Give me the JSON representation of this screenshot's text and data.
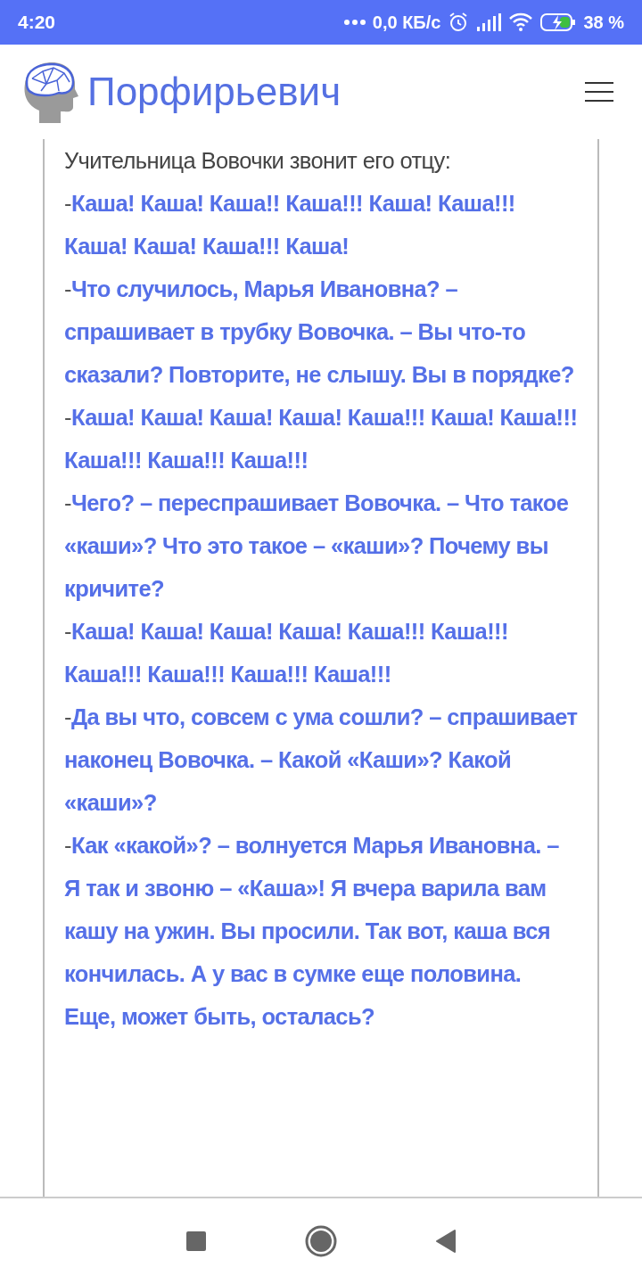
{
  "status_bar": {
    "time": "4:20",
    "network_speed": "0,0 КБ/с",
    "battery": "38 %"
  },
  "header": {
    "title": "Порфирьевич"
  },
  "story": [
    {
      "kind": "plain",
      "text": "Учительница Вовочки звонит его отцу:"
    },
    {
      "kind": "generated",
      "dash": "-",
      "text": "Каша! Каша! Каша!! Каша!!! Каша! Каша!!! Каша! Каша! Каша!!! Каша!"
    },
    {
      "kind": "generated",
      "dash": "-",
      "text": "Что случилось, Марья Ивановна? – спрашивает в трубку Вовочка. – Вы что-то сказали? Повторите, не слышу. Вы в порядке?"
    },
    {
      "kind": "generated",
      "dash": "-",
      "text": "Каша! Каша! Каша! Каша! Каша!!! Каша! Каша!!! Каша!!! Каша!!! Каша!!!"
    },
    {
      "kind": "generated",
      "dash": "-",
      "text": "Чего? – переспрашивает Вовочка. – Что такое «каши»? Что это такое – «каши»? Почему вы кричите?"
    },
    {
      "kind": "generated",
      "dash": "-",
      "text": "Каша! Каша! Каша! Каша! Каша!!! Каша!!! Каша!!! Каша!!! Каша!!! Каша!!!"
    },
    {
      "kind": "generated",
      "dash": "-",
      "text": "Да вы что, совсем с ума сошли? – спрашивает наконец Вовочка. – Какой «Каши»? Какой «каши»?"
    },
    {
      "kind": "generated",
      "dash": "-",
      "text": "Как «какой»? – волнуется Марья Ивановна. – Я так и звоню – «Каша»! Я вчера варила вам кашу на ужин. Вы просили. Так вот, каша вся кончилась. А у вас в сумке еще половина. Еще, может быть, осталась?"
    }
  ]
}
